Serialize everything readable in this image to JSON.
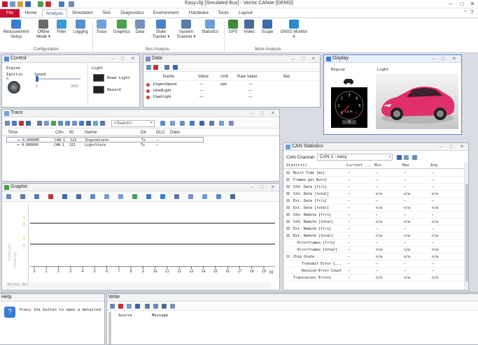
{
  "window": {
    "title": "Easy.cfg [Simulated Bus] - Vector CANoe [DEMO]",
    "min": "–",
    "max": "□",
    "close": "✕"
  },
  "ribbon_tabs": [
    "File",
    "Home",
    "Analysis",
    "Simulation",
    "Test",
    "Diagnostics",
    "Environment",
    "Hardware",
    "Tools",
    "Layout"
  ],
  "ribbon": {
    "buttons": [
      {
        "label1": "Measurement",
        "label2": "Setup",
        "color": "#3a7bd5"
      },
      {
        "label1": "Offline",
        "label2": "Mode ▾",
        "color": "#6a6a6a"
      },
      {
        "label1": "Filter",
        "label2": "",
        "color": "#3a9ad9"
      },
      {
        "label1": "Logging",
        "label2": "",
        "color": "#5a8fd0"
      },
      {
        "label1": "Trace",
        "label2": "",
        "color": "#6fa0d8"
      },
      {
        "label1": "Graphics",
        "label2": "",
        "color": "#4aa04a"
      },
      {
        "label1": "Data",
        "label2": "",
        "color": "#7890c0"
      },
      {
        "label1": "State",
        "label2": "Tracker ▾",
        "color": "#4a80c8"
      },
      {
        "label1": "System",
        "label2": "Scanner ▾",
        "color": "#5a7aa8"
      },
      {
        "label1": "Statistics",
        "label2": "",
        "color": "#6a9fd8"
      },
      {
        "label1": "GPS",
        "label2": "",
        "color": "#3a8a3a"
      },
      {
        "label1": "Video",
        "label2": "",
        "color": "#4a6a9a"
      },
      {
        "label1": "Scope",
        "label2": "",
        "color": "#3a6ab0"
      },
      {
        "label1": "GNSS Monitor",
        "label2": "▾",
        "color": "#2a8ad0"
      }
    ],
    "groups": [
      "Configuration",
      "Bus Analysis",
      "More Analysis"
    ]
  },
  "control": {
    "title": "Control",
    "engine_label": "Engine",
    "ignition_label": "Ignitio\nn",
    "speed_label": "Speed",
    "speed_min": "0",
    "speed_max": "3500",
    "light_label": "Light",
    "headlight_label": "Head Light",
    "hazard_label": "Hazard"
  },
  "data": {
    "title": "Data",
    "columns": [
      "Name",
      "Value",
      "Unit",
      "Raw Value",
      "Bar"
    ],
    "rows": [
      {
        "name": "EngineSpeed",
        "value": "—",
        "unit": "rpm",
        "raw": "—"
      },
      {
        "name": "HeadLight",
        "value": "—",
        "unit": "",
        "raw": "—"
      },
      {
        "name": "FlashLight",
        "value": "—",
        "unit": "",
        "raw": "—"
      }
    ]
  },
  "display": {
    "title": "Display",
    "engine_label": "Engine",
    "light_label": "Light",
    "gauge_ticks": [
      "0",
      "1",
      "2",
      "3",
      "4",
      "5",
      "6"
    ],
    "gauge_unit": "r.p.m.",
    "gauge_readout": "0",
    "car_value": "0"
  },
  "trace": {
    "title": "Trace",
    "search_placeholder": "<Search>",
    "columns": [
      "Time",
      "Chn",
      "ID",
      "Name",
      "Dir",
      "DLC",
      "Data"
    ],
    "rows": [
      {
        "time": "0.000000",
        "chn": "CAN 1",
        "id": "123",
        "name": "EngineState",
        "dir": "Tx",
        "dlc": "—"
      },
      {
        "time": "0.000000",
        "chn": "CAN 1",
        "id": "321",
        "name": "LightState",
        "dir": "Tx",
        "dlc": "—"
      }
    ]
  },
  "graphic": {
    "title": "Graphic",
    "marker_bar": "Marker Bar",
    "x_ticks": [
      "0",
      "1",
      "2",
      "3",
      "4",
      "5",
      "6",
      "7",
      "8",
      "9",
      "10",
      "11",
      "12",
      "13",
      "14",
      "15",
      "16",
      "17",
      "18",
      "19"
    ],
    "x_unit": "[s]",
    "y_left_labels": [
      "1",
      "0",
      "1",
      "0"
    ],
    "vertical_labels": [
      "FlashLight",
      "HeadLight"
    ]
  },
  "can_statistics": {
    "title": "CAN Statistics",
    "channel_label": "CAN Channel:",
    "channel_value": "CAN 1 - easy",
    "columns": [
      "Statistic",
      "Current ...",
      "Min",
      "Max",
      "Avg"
    ],
    "rows": [
      {
        "stat": "Burst Time [ms]",
        "cur": "—",
        "min": "—",
        "max": "—",
        "avg": "—",
        "exp": "⊞"
      },
      {
        "stat": "Frames per Burst",
        "cur": "—",
        "min": "—",
        "max": "—",
        "avg": "—",
        "exp": "⊞"
      },
      {
        "stat": "Std. Data [fr/s]",
        "cur": "—",
        "min": "—",
        "max": "—",
        "avg": "—",
        "exp": "⊞"
      },
      {
        "stat": "Std. Data [total]",
        "cur": "—",
        "min": "n/a",
        "max": "n/a",
        "avg": "n/a",
        "exp": "⊞"
      },
      {
        "stat": "Ext. Data [fr/s]",
        "cur": "—",
        "min": "—",
        "max": "—",
        "avg": "—",
        "exp": "⊞"
      },
      {
        "stat": "Ext. Data [total]",
        "cur": "—",
        "min": "n/a",
        "max": "n/a",
        "avg": "n/a",
        "exp": "⊞"
      },
      {
        "stat": "Std. Remote [fr/s]",
        "cur": "—",
        "min": "—",
        "max": "—",
        "avg": "—",
        "exp": "⊞"
      },
      {
        "stat": "Std. Remote [total]",
        "cur": "—",
        "min": "n/a",
        "max": "n/a",
        "avg": "n/a",
        "exp": "⊞"
      },
      {
        "stat": "Ext. Remote [fr/s]",
        "cur": "—",
        "min": "—",
        "max": "—",
        "avg": "—",
        "exp": "⊞"
      },
      {
        "stat": "Ext. Remote [total]",
        "cur": "—",
        "min": "n/a",
        "max": "n/a",
        "avg": "n/a",
        "exp": "⊞"
      },
      {
        "stat": "Errorframes [fr/s]",
        "cur": "—",
        "min": "—",
        "max": "—",
        "avg": "—",
        "exp": ""
      },
      {
        "stat": "Errorframes [total]",
        "cur": "—",
        "min": "n/a",
        "max": "n/a",
        "avg": "n/a",
        "exp": ""
      },
      {
        "stat": "Chip State",
        "cur": "—",
        "min": "n/a",
        "max": "n/a",
        "avg": "n/a",
        "exp": "⊟"
      },
      {
        "stat": "Transmit Error C...",
        "cur": "—",
        "min": "—",
        "max": "—",
        "avg": "—",
        "exp": ""
      },
      {
        "stat": "Receive Error Count",
        "cur": "—",
        "min": "—",
        "max": "—",
        "avg": "—",
        "exp": ""
      },
      {
        "stat": "Transceiver Errors",
        "cur": "—",
        "min": "n/a",
        "max": "n/a",
        "avg": "n/a",
        "exp": ""
      }
    ]
  },
  "help": {
    "title": "Help",
    "text": "Press the button to open a detailed"
  },
  "write": {
    "title": "Write",
    "col_source": "Source",
    "col_message": "Message"
  }
}
